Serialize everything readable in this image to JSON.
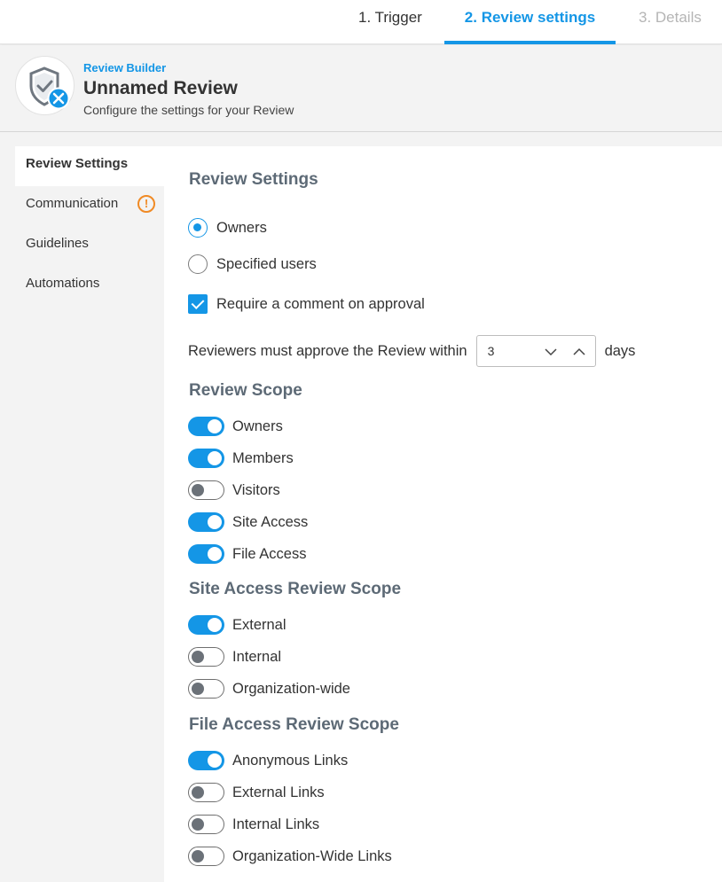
{
  "tabs": [
    {
      "label": "1. Trigger",
      "state": "done"
    },
    {
      "label": "2. Review settings",
      "state": "active"
    },
    {
      "label": "3. Details",
      "state": "disabled"
    }
  ],
  "header": {
    "kicker": "Review Builder",
    "title": "Unnamed Review",
    "subtitle": "Configure the settings for your Review"
  },
  "sidebar": {
    "items": [
      {
        "label": "Review Settings",
        "active": true
      },
      {
        "label": "Communication",
        "warning": "!"
      },
      {
        "label": "Guidelines"
      },
      {
        "label": "Automations"
      }
    ]
  },
  "settings": {
    "title": "Review Settings",
    "reviewer_options": [
      {
        "label": "Owners",
        "selected": true
      },
      {
        "label": "Specified users",
        "selected": false
      }
    ],
    "require_comment": {
      "label": "Require a comment on approval",
      "checked": true
    },
    "approve_within": {
      "prefix": "Reviewers must approve the Review within",
      "value": "3",
      "suffix": "days"
    }
  },
  "review_scope": {
    "title": "Review Scope",
    "items": [
      {
        "label": "Owners",
        "on": true
      },
      {
        "label": "Members",
        "on": true
      },
      {
        "label": "Visitors",
        "on": false
      },
      {
        "label": "Site Access",
        "on": true
      },
      {
        "label": "File Access",
        "on": true
      }
    ]
  },
  "site_access_scope": {
    "title": "Site Access Review Scope",
    "items": [
      {
        "label": "External",
        "on": true
      },
      {
        "label": "Internal",
        "on": false
      },
      {
        "label": "Organization-wide",
        "on": false
      }
    ]
  },
  "file_access_scope": {
    "title": "File Access Review Scope",
    "items": [
      {
        "label": "Anonymous Links",
        "on": true
      },
      {
        "label": "External Links",
        "on": false
      },
      {
        "label": "Internal Links",
        "on": false
      },
      {
        "label": "Organization-Wide Links",
        "on": false
      }
    ]
  },
  "colors": {
    "accent": "#1496e6",
    "warning": "#f08a24",
    "section_heading": "#5d6a76"
  }
}
